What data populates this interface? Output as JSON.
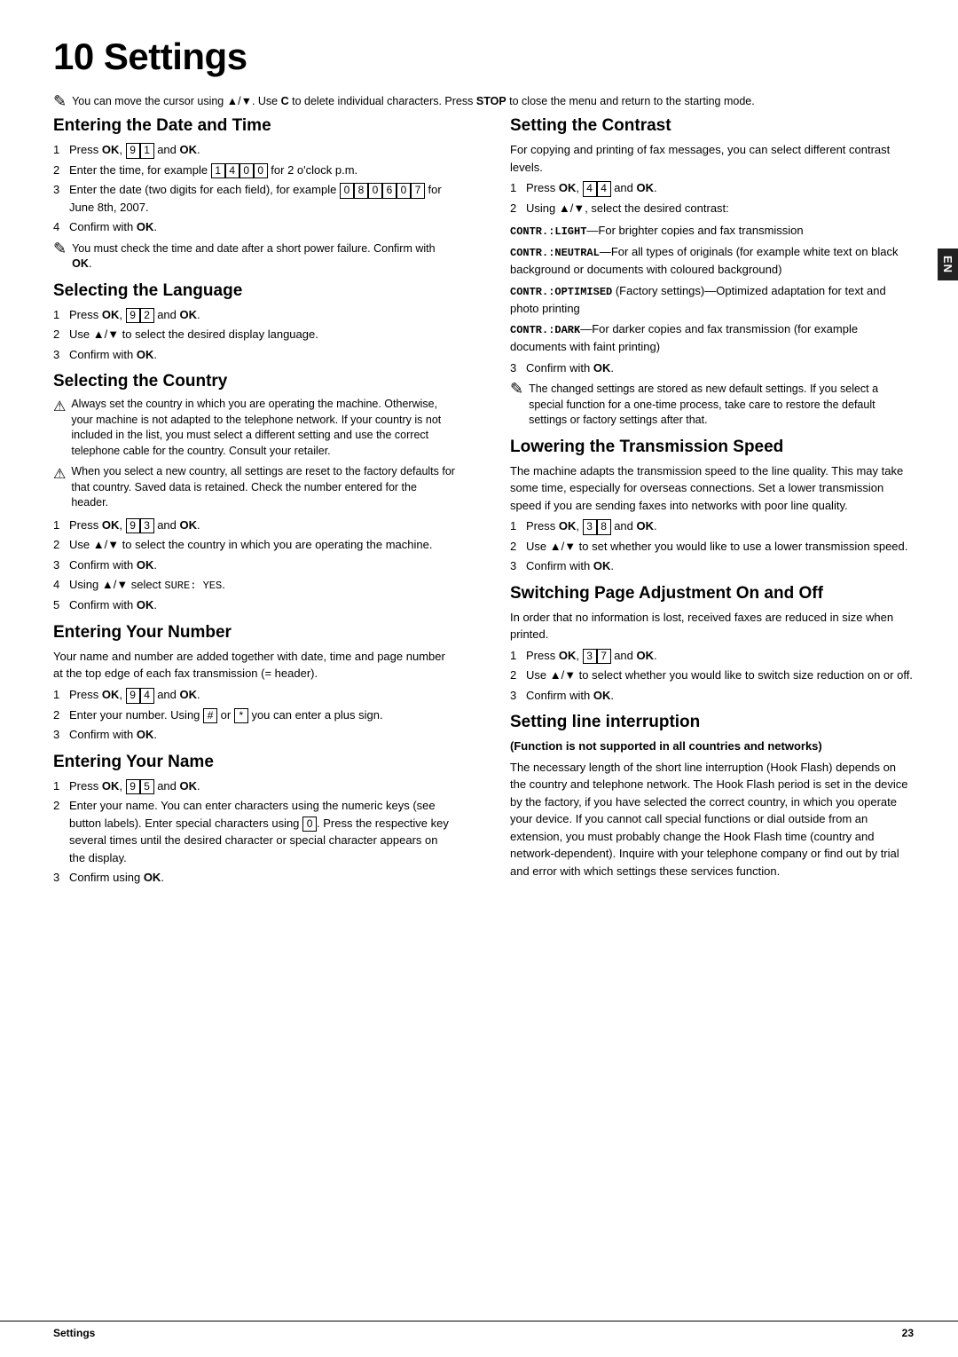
{
  "page": {
    "title": "10 Settings",
    "footer_left": "Settings",
    "footer_right": "23",
    "en_label": "EN"
  },
  "intro_note": {
    "icon": "✎",
    "text": "You can move the cursor using ▲/▼. Use C to delete individual characters. Press STOP to close the menu and return to the starting mode."
  },
  "sections": {
    "entering_date_time": {
      "heading": "Entering the Date and Time",
      "steps": [
        "Press OK, 9 1 and OK.",
        "Enter the time, for example 1 4 0 0 for 2 o'clock p.m.",
        "Enter the date (two digits for each field), for example 0 8 0 6 0 7 for June 8th, 2007.",
        "Confirm with OK."
      ],
      "note": {
        "icon": "✎",
        "text": "You must check the time and date after a short power failure. Confirm with OK."
      }
    },
    "selecting_language": {
      "heading": "Selecting the Language",
      "steps": [
        "Press OK, 9 2 and OK.",
        "Use ▲/▼ to select the desired display language.",
        "Confirm with OK."
      ]
    },
    "selecting_country": {
      "heading": "Selecting the Country",
      "warn1": "Always set the country in which you are operating the machine. Otherwise, your machine is not adapted to the telephone network. If your country is not included in the list, you must select a different setting and use the correct telephone cable for the country. Consult your retailer.",
      "warn2": "When you select a new country, all settings are reset to the factory defaults for that country. Saved data is retained. Check the number entered for the header.",
      "steps": [
        "Press OK, 9 3 and OK.",
        "Use ▲/▼ to select the country in which you are operating the machine.",
        "Confirm with OK.",
        "Using ▲/▼ select SURE: YES.",
        "Confirm with OK."
      ]
    },
    "entering_number": {
      "heading": "Entering Your Number",
      "intro": "Your name and number are added together with date, time and page number at the top edge of each fax transmission (= header).",
      "steps": [
        "Press OK, 9 4 and OK.",
        "Enter your number. Using # or * you can enter a plus sign.",
        "Confirm with OK."
      ]
    },
    "entering_name": {
      "heading": "Entering Your Name",
      "steps": [
        "Press OK, 9 5 and OK.",
        "Enter your name. You can enter characters using the numeric keys (see button labels). Enter special characters using 0. Press the respective key several times until the desired character or special character appears on the display.",
        "Confirm using OK."
      ]
    },
    "setting_contrast": {
      "heading": "Setting the Contrast",
      "intro": "For copying and printing of fax messages, you can select different contrast levels.",
      "steps": [
        "Press OK, 4 4 and OK.",
        "Using ▲/▼, select the desired contrast:"
      ],
      "contrast_options": [
        {
          "label": "CONTR.:LIGHT",
          "desc": "—For brighter copies and fax transmission"
        },
        {
          "label": "CONTR.:NEUTRAL",
          "desc": "—For all types of originals (for example white text on black background or documents with coloured background)"
        },
        {
          "label": "CONTR.:OPTIMISED",
          "desc": " (Factory settings)—Optimized adaptation for text and photo printing"
        },
        {
          "label": "CONTR.:DARK",
          "desc": "—For darker copies and fax transmission (for example documents with faint printing)"
        }
      ],
      "step3": "Confirm with OK.",
      "note": {
        "icon": "✎",
        "text": "The changed settings are stored as new default settings. If you select a special function for a one-time process, take care to restore the default settings or factory settings after that."
      }
    },
    "lowering_transmission": {
      "heading": "Lowering the Transmission Speed",
      "intro": "The machine adapts the transmission speed to the line quality. This may take some time, especially for overseas connections. Set a lower transmission speed if you are sending faxes into networks with poor line quality.",
      "steps": [
        "Press OK, 3 8 and OK.",
        "Use ▲/▼ to set whether you would like to use a lower transmission speed.",
        "Confirm with OK."
      ]
    },
    "switching_page": {
      "heading": "Switching Page Adjustment On and Off",
      "intro": "In order that no information is lost, received faxes are reduced in size when printed.",
      "steps": [
        "Press OK, 3 7 and OK.",
        "Use ▲/▼ to select whether you would like to switch size reduction on or off.",
        "Confirm with OK."
      ]
    },
    "setting_line": {
      "heading": "Setting line interruption",
      "subheading": "(Function is not supported in all countries and networks)",
      "text": "The necessary length of the short line interruption (Hook Flash) depends on the country and telephone network. The Hook Flash period is set in the device by the factory, if you have selected the correct country, in which you operate your device. If you cannot call special functions or dial outside from an extension, you must probably change the Hook Flash time (country and network-dependent). Inquire with your telephone company or find out by trial and error with which settings these services function."
    }
  }
}
